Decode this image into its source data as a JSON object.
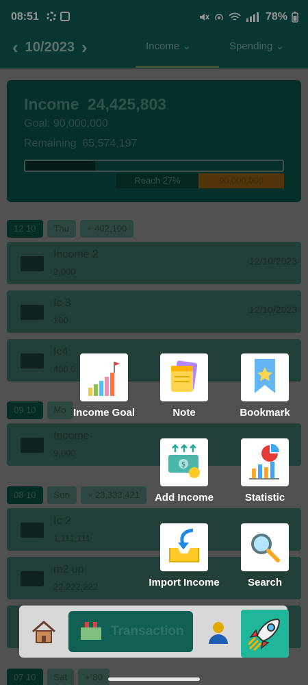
{
  "status_bar": {
    "time": "08:51",
    "battery": "78%"
  },
  "header": {
    "month": "10/2023",
    "tabs": [
      {
        "label": "Income"
      },
      {
        "label": "Spending"
      }
    ]
  },
  "summary": {
    "title": "Income",
    "total": "24,425,803",
    "goal_label": "Goal",
    "goal_value": "90,000,000",
    "remaining_label": "Remaining",
    "remaining_value": "65,574,197",
    "progress_fraction": 0.27,
    "reach_label": "Reach 27%",
    "goal_badge": "90,000,000"
  },
  "days": [
    {
      "date": "12 10",
      "weekday": "Thu",
      "total": "+ 402,100",
      "items": [
        {
          "name": "Income 2",
          "amount": "2,000",
          "date": "12/10/2023"
        },
        {
          "name": "Ic 3",
          "amount": "100",
          "date": "12/10/2023"
        },
        {
          "name": "Ic4",
          "amount": "400,0",
          "date": ""
        }
      ]
    },
    {
      "date": "09 10",
      "weekday": "Mo",
      "total": "",
      "items": [
        {
          "name": "Income",
          "amount": "9,000",
          "date": ""
        }
      ]
    },
    {
      "date": "08 10",
      "weekday": "Sun",
      "total": "+ 23,333,421",
      "items": [
        {
          "name": "Ic 2",
          "amount": "1,111,111",
          "date": ""
        },
        {
          "name": "m2 up",
          "amount": "22,222,222",
          "date": ""
        }
      ]
    },
    {
      "date": "07 10",
      "weekday": "Sat",
      "total": "+ 80",
      "items": []
    }
  ],
  "menu": {
    "items": [
      {
        "label": "Income Goal",
        "icon": "income-goal-icon"
      },
      {
        "label": "Note",
        "icon": "note-icon"
      },
      {
        "label": "Bookmark",
        "icon": "bookmark-icon"
      },
      {
        "label": "Add Income",
        "icon": "add-income-icon"
      },
      {
        "label": "Statistic",
        "icon": "statistic-icon"
      },
      {
        "label": "Import Income",
        "icon": "import-income-icon"
      },
      {
        "label": "Search",
        "icon": "search-icon"
      }
    ]
  },
  "bottom_nav": {
    "transaction_label": "Transaction"
  },
  "colors": {
    "accent": "#20b69a",
    "header": "#0d5f53",
    "goal_orange": "#f29a1f"
  }
}
